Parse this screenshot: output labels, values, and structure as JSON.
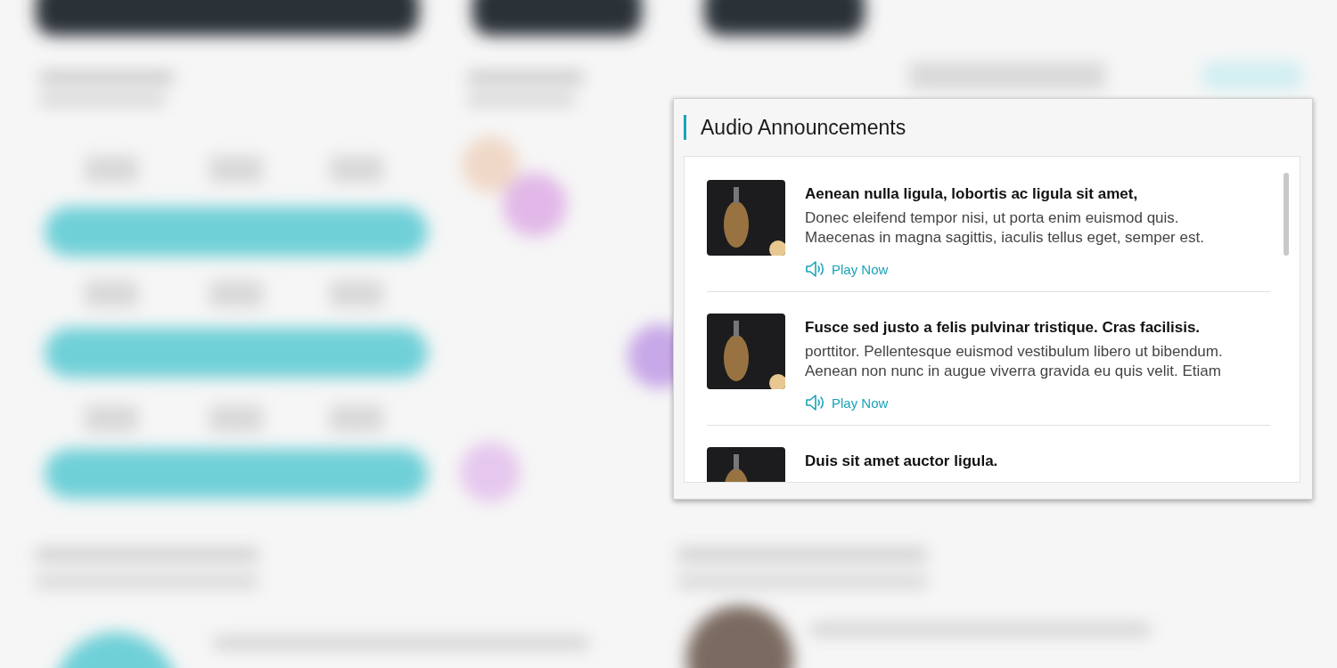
{
  "panel": {
    "title": "Audio Announcements",
    "items": [
      {
        "title": "Aenean nulla ligula, lobortis ac ligula sit amet,",
        "description": "Donec eleifend tempor nisi, ut porta enim euismod quis.\nMaecenas in magna sagittis, iaculis tellus eget, semper est.",
        "action": "Play Now"
      },
      {
        "title": "Fusce sed justo a felis pulvinar tristique. Cras facilisis.",
        "description": "porttitor. Pellentesque euismod vestibulum libero ut bibendum.\nAenean non nunc in augue viverra gravida eu quis velit. Etiam",
        "action": "Play Now"
      },
      {
        "title": "Duis sit amet auctor ligula."
      }
    ]
  }
}
